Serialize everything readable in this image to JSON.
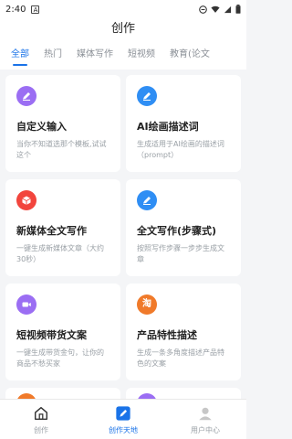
{
  "status_bar": {
    "time": "2:40",
    "app_badge": "A"
  },
  "header": {
    "title": "创作"
  },
  "tabs": [
    {
      "label": "全部",
      "active": true
    },
    {
      "label": "热门",
      "active": false
    },
    {
      "label": "媒体写作",
      "active": false
    },
    {
      "label": "短视频",
      "active": false
    },
    {
      "label": "教育(论文",
      "active": false
    }
  ],
  "cards": [
    {
      "title": "自定义输入",
      "desc": "当你不知道选那个模板,试试这个",
      "icon": "pen-icon",
      "color": "#9b6ef3"
    },
    {
      "title": "AI绘画描述词",
      "desc": "生成适用于AI绘画的描述词（prompt）",
      "icon": "pen-icon",
      "color": "#2f8ef4"
    },
    {
      "title": "新媒体全文写作",
      "desc": "一键生成新媒体文章（大约30秒）",
      "icon": "box-icon",
      "color": "#f2453d"
    },
    {
      "title": "全文写作(步骤式)",
      "desc": "按照写作步骤一步步生成文章",
      "icon": "pen-icon",
      "color": "#2f8ef4"
    },
    {
      "title": "短视频带货文案",
      "desc": "一键生成带货金句，让你的商品不愁买家",
      "icon": "video-icon",
      "color": "#9b6ef3"
    },
    {
      "title": "产品特性描述",
      "desc": "生成一条多角度描述产品特色的文案",
      "icon": "taobao-icon",
      "color": "#f07a2a"
    }
  ],
  "partial_cards": [
    {
      "color": "#f07a2a"
    },
    {
      "color": "#9b6ef3"
    }
  ],
  "bottom_nav": [
    {
      "label": "创作",
      "icon": "home-icon",
      "active": false
    },
    {
      "label": "创作天地",
      "icon": "edit-icon",
      "active": true
    },
    {
      "label": "用户中心",
      "icon": "user-icon",
      "active": false
    }
  ],
  "colors": {
    "accent": "#1a73e8",
    "background": "#f4f5f7"
  }
}
